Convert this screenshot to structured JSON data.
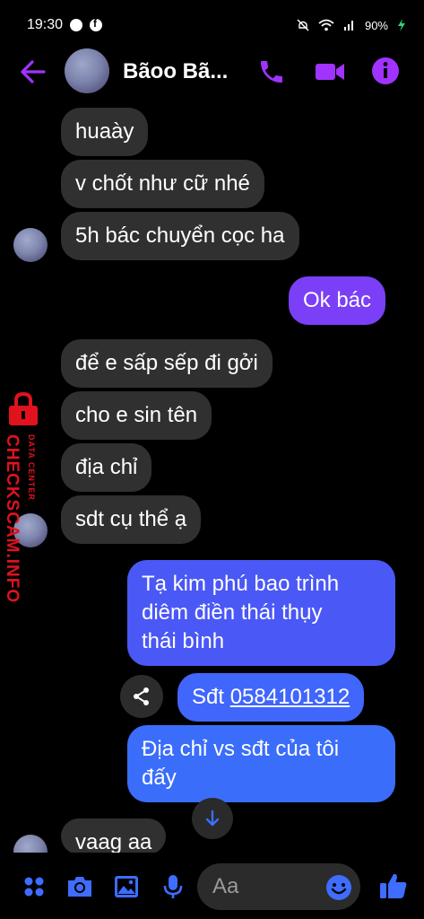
{
  "status_bar": {
    "time": "19:30",
    "battery": "90%"
  },
  "header": {
    "title": "Bãoo Bã..."
  },
  "messages": [
    {
      "text": "huaày"
    },
    {
      "text": "v chốt như cữ nhé"
    },
    {
      "text": "5h bác chuyển cọc ha"
    },
    {
      "text": "Ok bác"
    },
    {
      "text": "để e sấp sếp đi gởi"
    },
    {
      "text": "cho e sin tên"
    },
    {
      "text": "địa chỉ"
    },
    {
      "text": "sdt cụ thể ạ"
    },
    {
      "line1": "Tạ kim phú bao trình",
      "line2": "diêm điền thái thụy",
      "line3": "thái bình"
    },
    {
      "prefix": "Sđt ",
      "phone": "0584101312"
    },
    {
      "line1": "Địa chỉ vs sđt của tôi",
      "line2": "đấy"
    },
    {
      "text": "vaag aa"
    }
  ],
  "watermark": {
    "brand": "CHECKSCAM.INFO",
    "sub": "DATA CENTER"
  },
  "composer": {
    "placeholder": "Aa"
  },
  "colors": {
    "accent": "#a033ff",
    "outgoing_blue": "#3e6dff",
    "outgoing_purple": "#7a3ff7",
    "incoming": "#303030",
    "watermark": "#e0121e"
  },
  "icons": [
    "back-arrow-icon",
    "phone-icon",
    "video-camera-icon",
    "info-icon",
    "share-icon",
    "arrow-down-icon",
    "menu-dots-icon",
    "camera-icon",
    "image-icon",
    "microphone-icon",
    "emoji-icon",
    "like-icon"
  ]
}
